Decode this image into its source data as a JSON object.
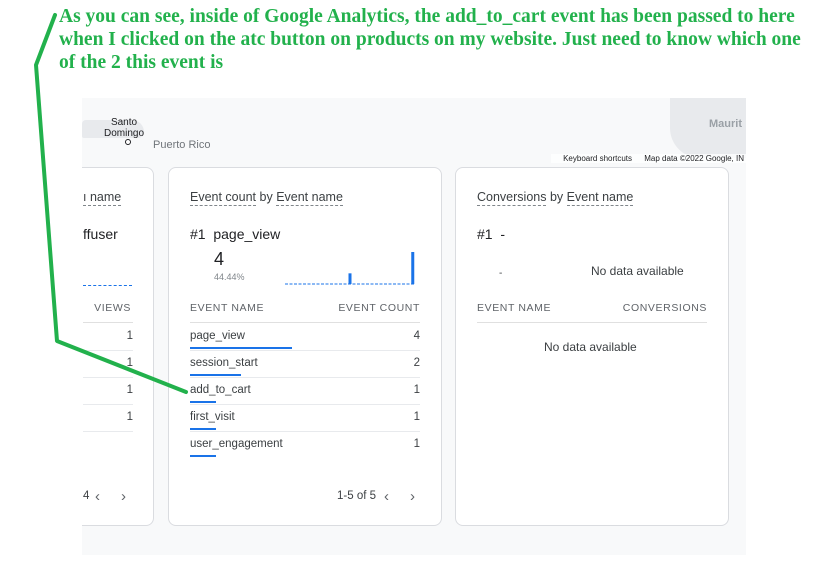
{
  "annotation": {
    "text": "As you can see, inside of Google Analytics, the add_to_cart event has been passed to here when I clicked on the atc button on products on my website. Just need to know which one of the 2 this event is",
    "color": "#22b14c"
  },
  "map": {
    "labels": {
      "santo_domingo": "Santo\nDomingo",
      "puerto_rico": "Puerto Rico",
      "mauritania": "Maurit"
    },
    "footer": {
      "shortcuts": "Keyboard shortcuts",
      "attribution": "Map data ©2022 Google, IN"
    }
  },
  "left_card": {
    "title_fragment": "ı name",
    "rank_fragment": "ffuser",
    "column_header": "VIEWS",
    "values": [
      "1",
      "1",
      "1",
      "1"
    ],
    "pager_fragment": "4"
  },
  "event_count_card": {
    "title_part1": "Event count",
    "title_mid": "by",
    "title_part2": "Event name",
    "rank": "#1",
    "top_event": "page_view",
    "top_value": "4",
    "top_percent": "44.44%",
    "col_name": "EVENT NAME",
    "col_value": "EVENT COUNT",
    "rows": [
      {
        "name": "page_view",
        "value": "4",
        "count": 4
      },
      {
        "name": "session_start",
        "value": "2",
        "count": 2
      },
      {
        "name": "add_to_cart",
        "value": "1",
        "count": 1
      },
      {
        "name": "first_visit",
        "value": "1",
        "count": 1
      },
      {
        "name": "user_engagement",
        "value": "1",
        "count": 1
      }
    ],
    "max_count": 4,
    "sparkline": [
      0,
      0,
      0,
      0,
      0,
      0,
      0,
      0,
      0,
      0,
      0,
      0,
      0,
      0,
      1,
      0,
      0,
      0,
      0,
      0,
      0,
      0,
      0,
      0,
      0,
      0,
      0,
      0,
      3
    ],
    "pager": "1-5 of 5",
    "accent": "#1a73e8"
  },
  "conversions_card": {
    "title_part1": "Conversions",
    "title_mid": "by",
    "title_part2": "Event name",
    "rank": "#1",
    "top_event": "-",
    "top_value": "-",
    "chart_no_data": "No data available",
    "col_name": "EVENT NAME",
    "col_value": "CONVERSIONS",
    "table_no_data": "No data available"
  }
}
